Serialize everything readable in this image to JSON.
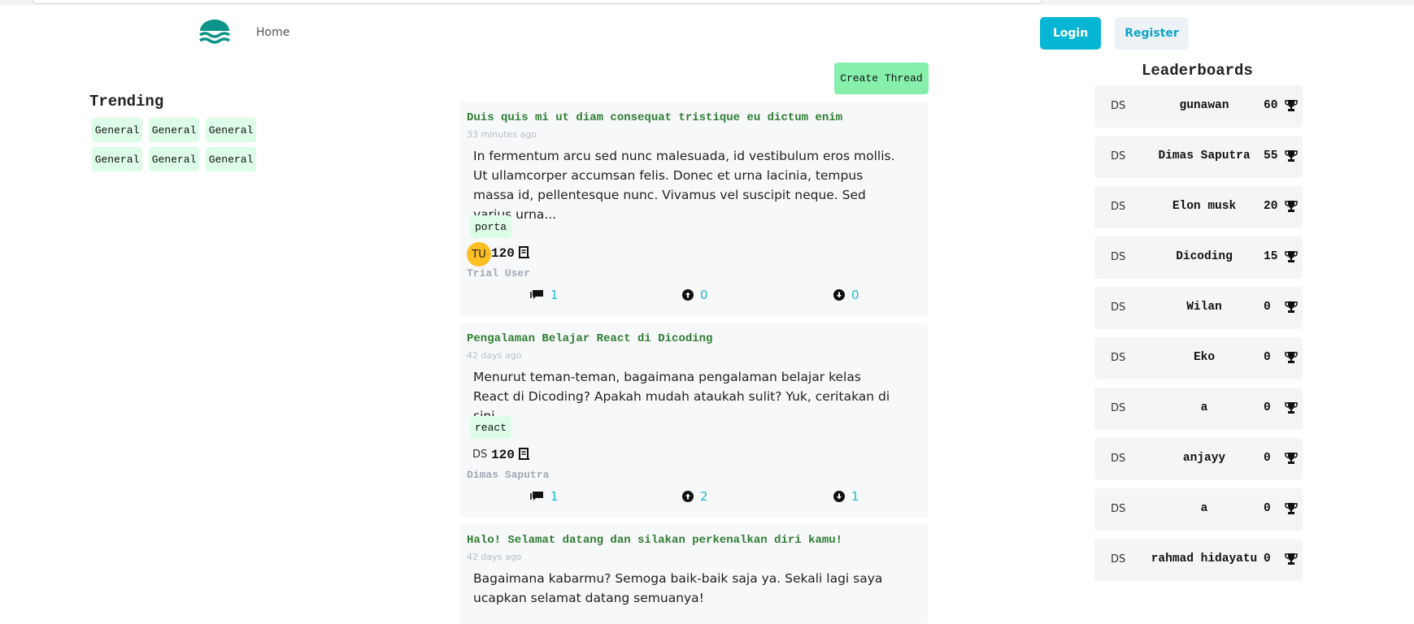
{
  "header": {
    "logo_icon": "wave-logo-icon",
    "home_label": "Home",
    "login_label": "Login",
    "register_label": "Register",
    "brand_color": "#0d9488",
    "login_color": "#06b6d4"
  },
  "trending": {
    "title": "Trending",
    "tags": [
      "General",
      "General",
      "General",
      "General",
      "General",
      "General"
    ]
  },
  "create_thread_label": "Create Thread",
  "threads": [
    {
      "title": "Duis quis mi ut diam consequat tristique eu dictum enim",
      "time": "33 minutes ago",
      "body": "In fermentum arcu sed nunc malesuada, id vestibulum eros mollis. Ut ullamcorper accumsan felis. Donec et urna lacinia, tempus massa id, pellentesque nunc. Vivamus vel suscipit neque. Sed varius urna...",
      "tag": "porta",
      "avatar": "TU",
      "score": "120",
      "author": "Trial User",
      "comments": "1",
      "upvotes": "0",
      "downvotes": "0"
    },
    {
      "title": "Pengalaman Belajar React di Dicoding",
      "time": "42 days ago",
      "body": "Menurut teman-teman, bagaimana pengalaman belajar kelas React di Dicoding? Apakah mudah ataukah sulit? Yuk, ceritakan di sini....",
      "tag": "react",
      "avatar": "DS",
      "score": "120",
      "author": "Dimas Saputra",
      "comments": "1",
      "upvotes": "2",
      "downvotes": "1"
    },
    {
      "title": "Halo! Selamat datang dan silakan perkenalkan diri kamu!",
      "time": "42 days ago",
      "body": "Bagaimana kabarmu? Semoga baik-baik saja ya. Sekali lagi saya ucapkan selamat datang semuanya!"
    }
  ],
  "leaderboard": {
    "title": "Leaderboards",
    "entries": [
      {
        "avatar": "DS",
        "name": "gunawan",
        "score": "60"
      },
      {
        "avatar": "DS",
        "name": "Dimas Saputra",
        "score": "55"
      },
      {
        "avatar": "DS",
        "name": "Elon musk",
        "score": "20"
      },
      {
        "avatar": "DS",
        "name": "Dicoding",
        "score": "15"
      },
      {
        "avatar": "DS",
        "name": "Wilan",
        "score": "0"
      },
      {
        "avatar": "DS",
        "name": "Eko",
        "score": "0"
      },
      {
        "avatar": "DS",
        "name": "a",
        "score": "0"
      },
      {
        "avatar": "DS",
        "name": "anjayy",
        "score": "0"
      },
      {
        "avatar": "DS",
        "name": "a",
        "score": "0"
      },
      {
        "avatar": "DS",
        "name": "rahmad hidayatu",
        "score": "0"
      }
    ]
  }
}
